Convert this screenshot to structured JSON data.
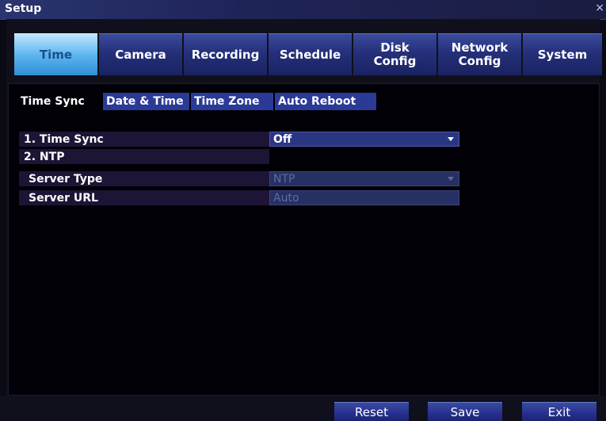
{
  "window": {
    "title": "Setup",
    "close_glyph": "×"
  },
  "tabs": [
    {
      "label": "Time"
    },
    {
      "label": "Camera"
    },
    {
      "label": "Recording"
    },
    {
      "label": "Schedule"
    },
    {
      "label": "Disk\nConfig"
    },
    {
      "label": "Network\nConfig"
    },
    {
      "label": "System"
    }
  ],
  "subtabs": [
    {
      "label": "Time Sync"
    },
    {
      "label": "Date & Time"
    },
    {
      "label": "Time Zone"
    },
    {
      "label": "Auto Reboot"
    }
  ],
  "form": {
    "time_sync": {
      "label": "1. Time Sync",
      "value": "Off"
    },
    "ntp": {
      "label": "2. NTP"
    },
    "server_type": {
      "label": "Server Type",
      "value": "NTP"
    },
    "server_url": {
      "label": "Server URL",
      "value": "Auto"
    }
  },
  "buttons": {
    "reset": "Reset",
    "save": "Save",
    "exit": "Exit"
  },
  "colors": {
    "accent_active_tab": "#5fb6ef",
    "tab": "#25307a",
    "background": "#000006"
  }
}
